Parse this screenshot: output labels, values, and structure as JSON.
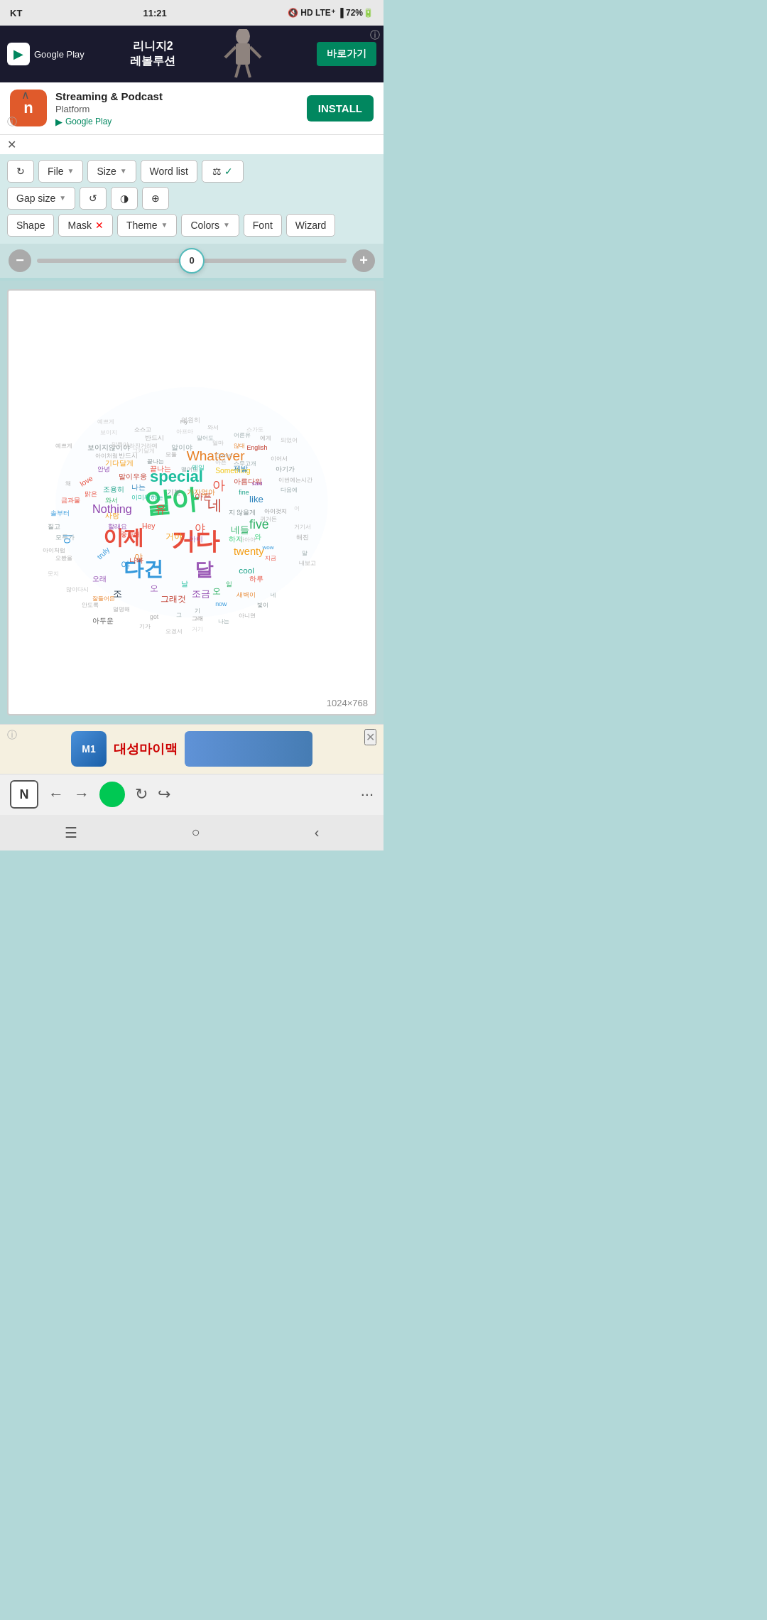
{
  "statusBar": {
    "carrier": "KT",
    "time": "11:21",
    "battery": "72%",
    "icons": "🔇 HD LTE⁺ 📶"
  },
  "adBannerTop": {
    "googlePlayLabel": "Google Play",
    "adText1": "리니지2",
    "adText2": "레볼루션",
    "installLabel": "바로가기",
    "infoIcon": "ⓘ"
  },
  "appInstallBanner": {
    "appLetter": "n",
    "titleLine1": "Streaming & Podcast",
    "titleLine2": "Platform",
    "storeLabel": "Google Play",
    "installLabel": "INSTALL",
    "expandIcon": "∧",
    "closeIcon": "✕",
    "infoIcon": "ⓘ"
  },
  "toolbar": {
    "refreshLabel": "↻",
    "fileLabel": "File",
    "sizeLabel": "Size",
    "wordListLabel": "Word list",
    "scaleLabel": "⚖",
    "checkLabel": "✓",
    "gapSizeLabel": "Gap size",
    "rotateLabel": "↺",
    "contrastLabel": "◑",
    "targetLabel": "⊕",
    "shapeLabel": "Shape",
    "maskLabel": "Mask",
    "maskClose": "✕",
    "themeLabel": "Theme",
    "colorsLabel": "Colors",
    "fontLabel": "Font",
    "wizardLabel": "Wizard"
  },
  "slider": {
    "value": "0",
    "minusIcon": "−",
    "plusIcon": "+"
  },
  "canvas": {
    "sizeLabel": "1024×768"
  },
  "adBottom": {
    "logoText": "대성마이맥",
    "closeIcon": "✕",
    "infoIcon": "ⓘ"
  },
  "browserNav": {
    "nLabel": "N",
    "backIcon": "←",
    "forwardIcon": "→",
    "refreshIcon": "↻",
    "shareIcon": "↪",
    "moreIcon": "···"
  },
  "systemNav": {
    "menuIcon": "☰",
    "homeIcon": "○",
    "backIcon": "‹"
  }
}
